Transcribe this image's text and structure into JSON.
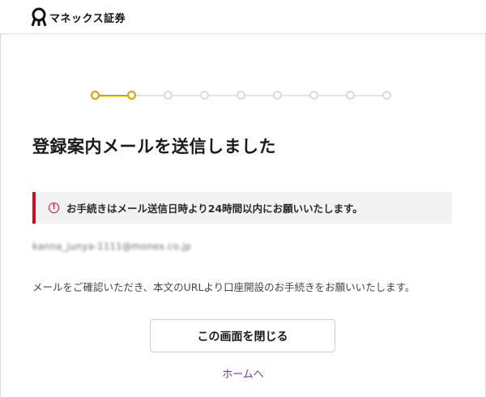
{
  "header": {
    "logo_text": "マネックス証券"
  },
  "stepper": {
    "total_steps": 9,
    "current_step": 2
  },
  "main": {
    "title": "登録案内メールを送信しました",
    "alert": {
      "icon": "exclamation-circle-icon",
      "text": "お手続きはメール送信日時より24時間以内にお願いいたします。"
    },
    "email": "kanna_junya-1111@monex.co.jp",
    "description": "メールをご確認いただき、本文のURLより口座開設のお手続きをお願いいたします。",
    "close_button_label": "この画面を閉じる",
    "home_link_label": "ホームへ"
  },
  "colors": {
    "accent": "#d4a100",
    "alert_border": "#c8102e",
    "link": "#6b3fa0"
  }
}
